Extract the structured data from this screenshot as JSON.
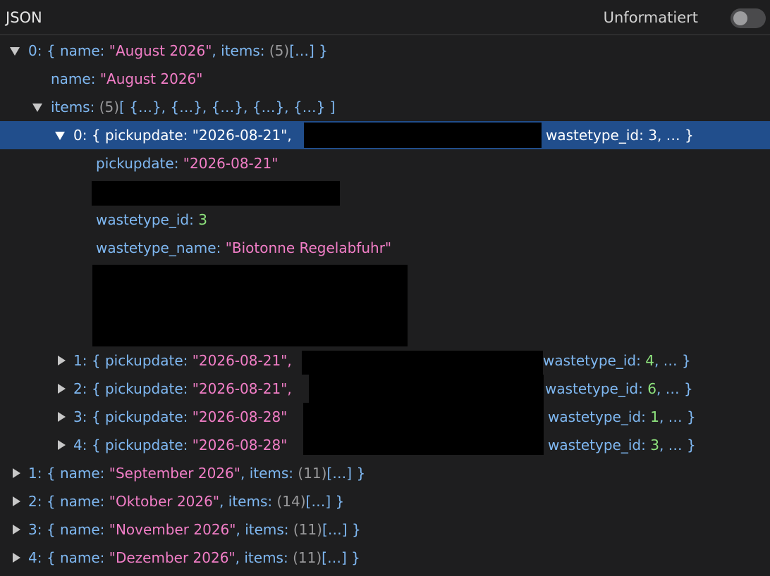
{
  "header": {
    "title": "JSON",
    "toggle_label": "Unformatiert"
  },
  "tree": {
    "r0": {
      "key": "0",
      "name_key": "name",
      "name_val": "\"August 2026\"",
      "items_key": "items",
      "count": "(5)",
      "preview": "[…]"
    },
    "r1": {
      "key": "name",
      "val": "\"August 2026\""
    },
    "r2": {
      "key": "items",
      "count": "(5)",
      "preview": "[ {…}, {…}, {…}, {…}, {…} ]"
    },
    "r3": {
      "key": "0",
      "pk": "pickupdate",
      "pv": "\"2026-08-21\",",
      "wk": "wastetype_id",
      "wv": "3",
      "tail": ", … }"
    },
    "r4": {
      "key": "pickupdate",
      "val": "\"2026-08-21\""
    },
    "r5": {
      "key": "wastetype_id",
      "val": "3"
    },
    "r6": {
      "key": "wastetype_name",
      "val": "\"Biotonne Regelabfuhr\""
    },
    "r7": {
      "key": "1",
      "pk": "pickupdate",
      "pv": "\"2026-08-21\",",
      "wk": "wastetype_id",
      "wv": "4",
      "tail": ", … }"
    },
    "r8": {
      "key": "2",
      "pk": "pickupdate",
      "pv": "\"2026-08-21\",",
      "wk": "wastetype_id",
      "wv": "6",
      "tail": ", … }"
    },
    "r9": {
      "key": "3",
      "pk": "pickupdate",
      "pv": "\"2026-08-28\"",
      "wk": "wastetype_id",
      "wv": "1",
      "tail": ", … }"
    },
    "r10": {
      "key": "4",
      "pk": "pickupdate",
      "pv": "\"2026-08-28\"",
      "wk": "wastetype_id",
      "wv": "3",
      "tail": ", … }"
    },
    "r11": {
      "key": "1",
      "name_key": "name",
      "name_val": "\"September 2026\"",
      "items_key": "items",
      "count": "(11)",
      "preview": "[…]"
    },
    "r12": {
      "key": "2",
      "name_key": "name",
      "name_val": "\"Oktober 2026\"",
      "items_key": "items",
      "count": "(14)",
      "preview": "[…]"
    },
    "r13": {
      "key": "3",
      "name_key": "name",
      "name_val": "\"November 2026\"",
      "items_key": "items",
      "count": "(11)",
      "preview": "[…]"
    },
    "r14": {
      "key": "4",
      "name_key": "name",
      "name_val": "\"Dezember 2026\"",
      "items_key": "items",
      "count": "(11)",
      "preview": "[…]"
    }
  },
  "punct": {
    "colon": ":",
    "open": "{",
    "close": "}",
    "comma": ",",
    "tail_close": " }"
  }
}
